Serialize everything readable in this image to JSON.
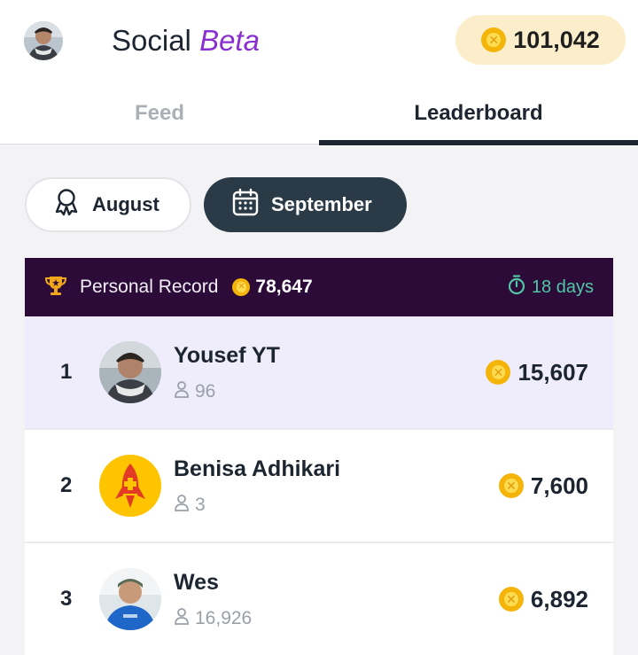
{
  "header": {
    "title_main": "Social",
    "title_beta": "Beta",
    "coin_balance": "101,042"
  },
  "tabs": [
    {
      "label": "Feed",
      "active": false
    },
    {
      "label": "Leaderboard",
      "active": true
    }
  ],
  "filters": {
    "august_label": "August",
    "september_label": "September",
    "selected": "September"
  },
  "personal_record": {
    "label": "Personal Record",
    "value": "78,647",
    "days_left": "18 days"
  },
  "leaderboard": [
    {
      "rank": "1",
      "name": "Yousef YT",
      "followers": "96",
      "points": "15,607",
      "highlight": true
    },
    {
      "rank": "2",
      "name": "Benisa Adhikari",
      "followers": "3",
      "points": "7,600",
      "highlight": false
    },
    {
      "rank": "3",
      "name": "Wes",
      "followers": "16,926",
      "points": "6,892",
      "highlight": false
    }
  ],
  "colors": {
    "accent_purple": "#8a2fd0",
    "record_bar": "#2c0b39",
    "coin_gold": "#f5b40a",
    "highlight_row": "#efedfc",
    "timer_green": "#52c7a6"
  }
}
